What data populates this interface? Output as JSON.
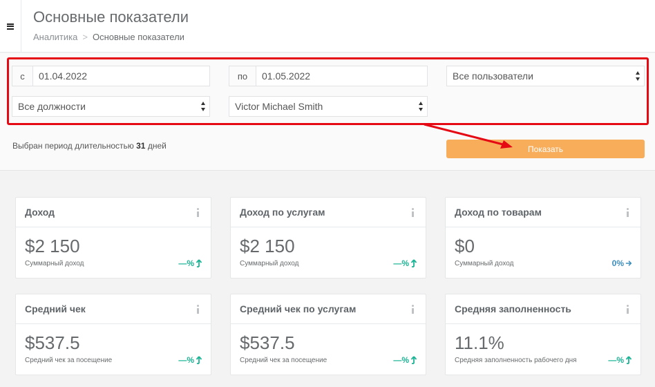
{
  "header": {
    "title": "Основные показатели",
    "breadcrumb": {
      "parent": "Аналитика",
      "separator": ">",
      "current": "Основные показатели"
    }
  },
  "filters": {
    "from": {
      "prefix": "с",
      "value": "01.04.2022"
    },
    "to": {
      "prefix": "по",
      "value": "01.05.2022"
    },
    "users_select": "Все пользователи",
    "positions_select": "Все должности",
    "employee_select": "Victor Michael Smith",
    "period_prefix": "Выбран период длительностью",
    "period_days": "31",
    "period_suffix": "дней",
    "show_button": "Показать"
  },
  "colors": {
    "accent": "#f8ad5b",
    "highlight": "#e50914",
    "trend_up": "#1ab394",
    "trend_neutral": "#3c8dbc"
  },
  "cards": [
    {
      "title": "Доход",
      "value": "$2 150",
      "sub": "Суммарный доход",
      "trend": "—%",
      "trend_icon": "arrow-up-icon"
    },
    {
      "title": "Доход по услугам",
      "value": "$2 150",
      "sub": "Суммарный доход",
      "trend": "—%",
      "trend_icon": "arrow-up-icon"
    },
    {
      "title": "Доход по товарам",
      "value": "$0",
      "sub": "Суммарный доход",
      "trend": "0%",
      "trend_icon": "arrow-right-icon"
    },
    {
      "title": "Средний чек",
      "value": "$537.5",
      "sub": "Средний чек за посещение",
      "trend": "—%",
      "trend_icon": "arrow-up-icon"
    },
    {
      "title": "Средний чек по услугам",
      "value": "$537.5",
      "sub": "Средний чек за посещение",
      "trend": "—%",
      "trend_icon": "arrow-up-icon"
    },
    {
      "title": "Средняя заполненность",
      "value": "11.1%",
      "sub": "Средняя заполненность рабочего дня",
      "trend": "—%",
      "trend_icon": "arrow-up-icon"
    }
  ]
}
